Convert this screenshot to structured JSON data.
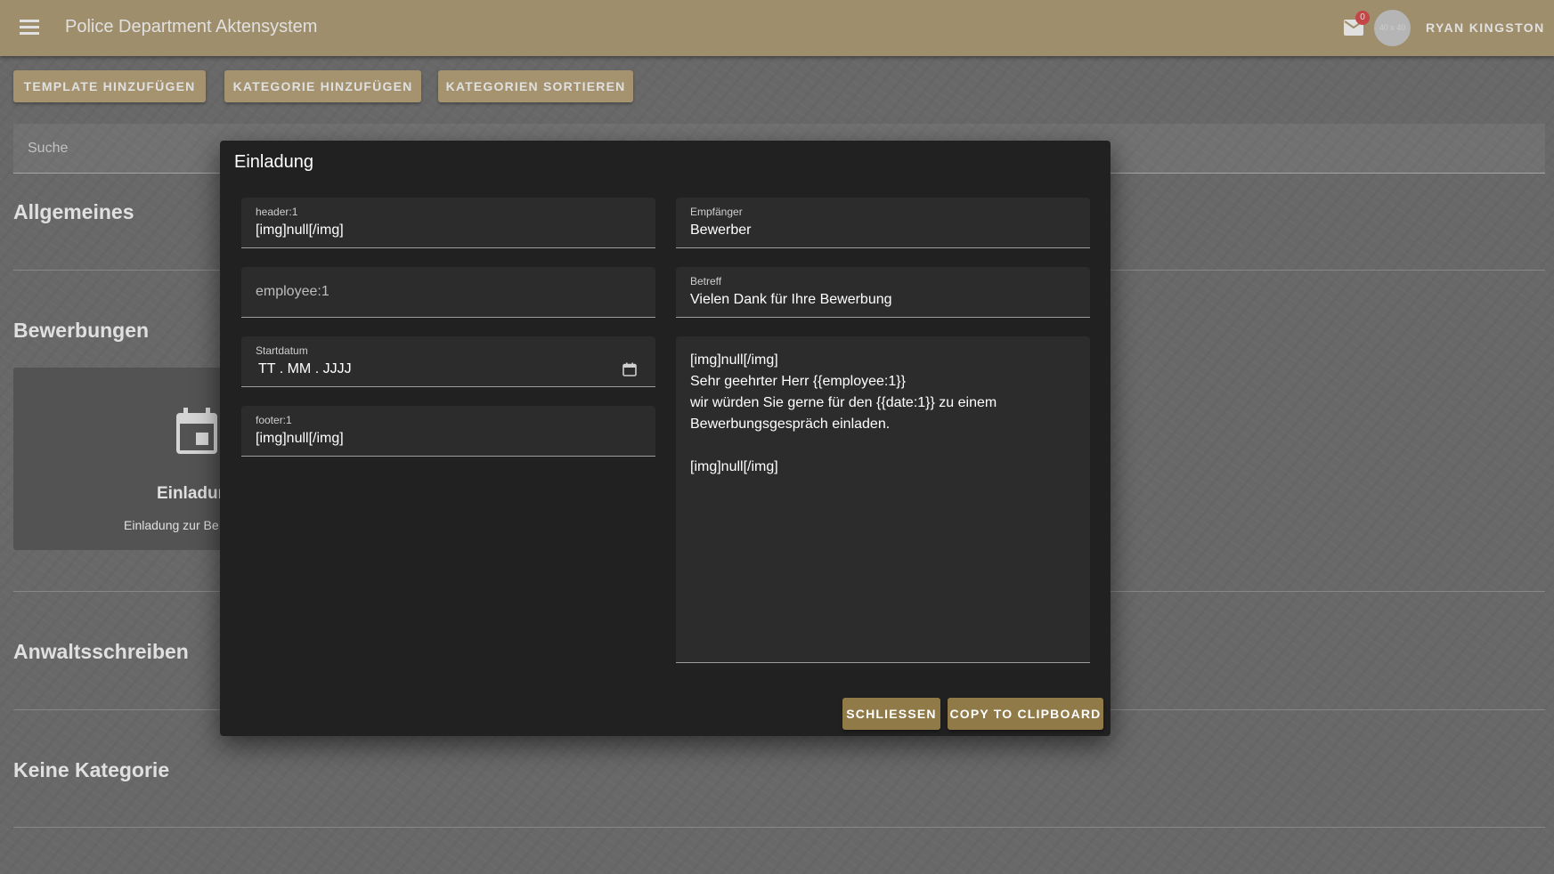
{
  "app": {
    "title": "Police Department Aktensystem",
    "user_name": "RYAN KINGSTON",
    "mail_count": "0",
    "avatar_text": "40 x 40",
    "accent": "#b6a27a"
  },
  "toolbar": {
    "add_template": "TEMPLATE HINZUFÜGEN",
    "add_category": "KATEGORIE HINZUFÜGEN",
    "sort_categories": "KATEGORIEN SORTIEREN"
  },
  "search": {
    "placeholder": "Suche"
  },
  "categories": [
    "Allgemeines",
    "Bewerbungen",
    "Anwaltsschreiben",
    "Keine Kategorie"
  ],
  "card": {
    "title": "Einladun",
    "subtitle": "Einladung zur Be",
    "icon": "calendar-icon"
  },
  "dialog": {
    "title": "Einladung",
    "header_field": {
      "label": "header:1",
      "value": "[img]null[/img]"
    },
    "employee_field": {
      "placeholder": "employee:1"
    },
    "start_date_field": {
      "label": "Startdatum",
      "value": "TT . MM . JJJJ"
    },
    "footer_field": {
      "label": "footer:1",
      "value": "[img]null[/img]"
    },
    "recipient_field": {
      "label": "Empfänger",
      "value": "Bewerber"
    },
    "subject_field": {
      "label": "Betreff",
      "value": "Vielen Dank für Ihre Bewerbung"
    },
    "body_lines": [
      "[img]null[/img]",
      "Sehr geehrter Herr {{employee:1}}",
      "wir würden Sie gerne für den {{date:1}} zu einem",
      "Bewerbungsgespräch einladen.",
      "",
      "[img]null[/img]"
    ],
    "close_button": "SCHLIESSEN",
    "copy_button": "COPY TO CLIPBOARD",
    "button_color": "#8f7a48"
  }
}
